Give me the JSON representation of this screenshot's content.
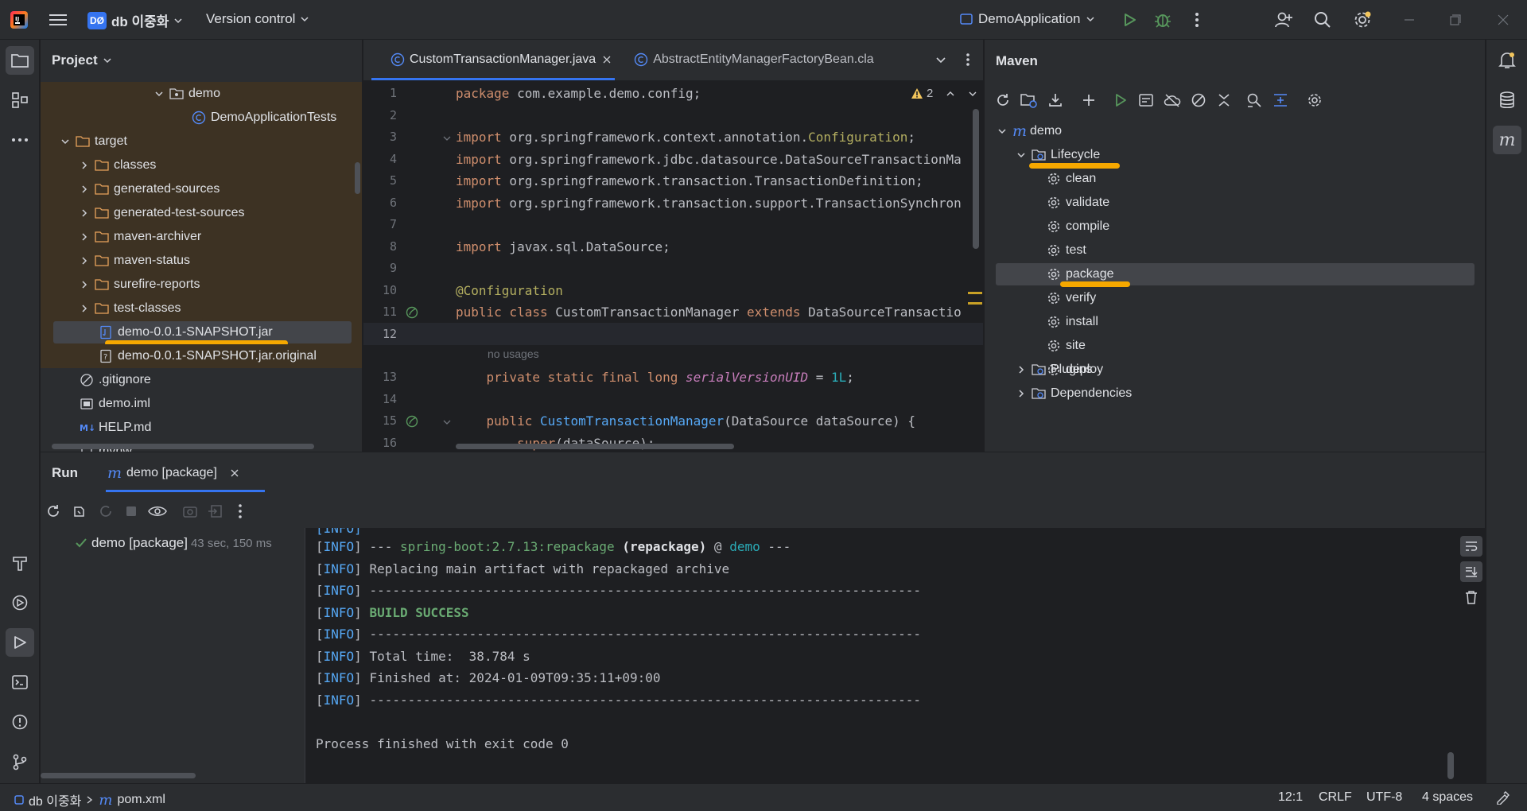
{
  "titlebar": {
    "project_badge": "DØ",
    "project_name": "db 이중화",
    "vcs": "Version control",
    "run_config": "DemoApplication",
    "icons": [
      "app-logo-icon",
      "hamburger-menu-icon",
      "run-icon",
      "debug-icon",
      "more-icon",
      "add-user-icon",
      "search-icon",
      "settings-icon",
      "minimize-icon",
      "restore-icon",
      "close-icon"
    ]
  },
  "project": {
    "title": "Project",
    "rows": [
      {
        "label": "demo",
        "icon": "package-folder-icon"
      },
      {
        "label": "DemoApplicationTests",
        "icon": "class-icon"
      },
      {
        "label": "target",
        "icon": "folder-icon"
      },
      {
        "label": "classes",
        "icon": "folder-icon"
      },
      {
        "label": "generated-sources",
        "icon": "folder-icon"
      },
      {
        "label": "generated-test-sources",
        "icon": "folder-icon"
      },
      {
        "label": "maven-archiver",
        "icon": "folder-icon"
      },
      {
        "label": "maven-status",
        "icon": "folder-icon"
      },
      {
        "label": "surefire-reports",
        "icon": "folder-icon"
      },
      {
        "label": "test-classes",
        "icon": "folder-icon"
      },
      {
        "label": "demo-0.0.1-SNAPSHOT.jar",
        "icon": "jar-icon"
      },
      {
        "label": "demo-0.0.1-SNAPSHOT.jar.original",
        "icon": "unknown-file-icon"
      },
      {
        "label": ".gitignore",
        "icon": "ignore-file-icon"
      },
      {
        "label": "demo.iml",
        "icon": "module-file-icon"
      },
      {
        "label": "HELP.md",
        "icon": "markdown-icon"
      },
      {
        "label": "mvnw",
        "icon": "file-icon"
      }
    ],
    "highlight_color": "#f6a800"
  },
  "editor": {
    "tabs": [
      {
        "label": "CustomTransactionManager.java"
      },
      {
        "label": "AbstractEntityManagerFactoryBean.cla"
      }
    ],
    "warning_count": "2",
    "usage_hint": "no usages",
    "lines": [
      {
        "n": "1",
        "text": "package com.example.demo.config;"
      },
      {
        "n": "2",
        "text": ""
      },
      {
        "n": "3",
        "text": "import org.springframework.context.annotation.Configuration;"
      },
      {
        "n": "4",
        "text": "import org.springframework.jdbc.datasource.DataSourceTransactionMa"
      },
      {
        "n": "5",
        "text": "import org.springframework.transaction.TransactionDefinition;"
      },
      {
        "n": "6",
        "text": "import org.springframework.transaction.support.TransactionSynchron"
      },
      {
        "n": "7",
        "text": ""
      },
      {
        "n": "8",
        "text": "import javax.sql.DataSource;"
      },
      {
        "n": "9",
        "text": ""
      },
      {
        "n": "10",
        "text": "@Configuration"
      },
      {
        "n": "11",
        "text": "public class CustomTransactionManager extends DataSourceTransactio"
      },
      {
        "n": "12",
        "text": ""
      },
      {
        "n": "13",
        "text": "    private static final long serialVersionUID = 1L;"
      },
      {
        "n": "14",
        "text": ""
      },
      {
        "n": "15",
        "text": "    public CustomTransactionManager(DataSource dataSource) {"
      },
      {
        "n": "16",
        "text": "        super(dataSource);"
      }
    ]
  },
  "maven": {
    "title": "Maven",
    "root": "demo",
    "lifecycle": "Lifecycle",
    "goals": [
      "clean",
      "validate",
      "compile",
      "test",
      "package",
      "verify",
      "install",
      "site",
      "deploy"
    ],
    "plugins": "Plugins",
    "dependencies": "Dependencies",
    "selected_goal": "package"
  },
  "run": {
    "title": "Run",
    "tab_label": "demo [package]",
    "tree_item": "demo [package]",
    "tree_time": "43 sec, 150 ms",
    "console": [
      {
        "prefix": "[INFO]",
        "text": ""
      },
      {
        "prefix": "[INFO]",
        "text": " --- spring-boot:2.7.13:repackage (repackage) @ demo ---"
      },
      {
        "prefix": "[INFO]",
        "text": " Replacing main artifact with repackaged archive"
      },
      {
        "prefix": "[INFO]",
        "text": " ------------------------------------------------------------------------"
      },
      {
        "prefix": "[INFO]",
        "text": " BUILD SUCCESS"
      },
      {
        "prefix": "[INFO]",
        "text": " ------------------------------------------------------------------------"
      },
      {
        "prefix": "[INFO]",
        "text": " Total time:  38.784 s"
      },
      {
        "prefix": "[INFO]",
        "text": " Finished at: 2024-01-09T09:35:11+09:00"
      },
      {
        "prefix": "[INFO]",
        "text": " ------------------------------------------------------------------------"
      },
      {
        "prefix": "",
        "text": ""
      },
      {
        "prefix": "",
        "text": "Process finished with exit code 0"
      }
    ],
    "plugin_name": "spring-boot:2.7.13:repackage",
    "execution": "(repackage)",
    "module": "demo"
  },
  "statusbar": {
    "project": "db 이중화",
    "file": "pom.xml",
    "position": "12:1",
    "line_sep": "CRLF",
    "encoding": "UTF-8",
    "indent": "4 spaces"
  }
}
